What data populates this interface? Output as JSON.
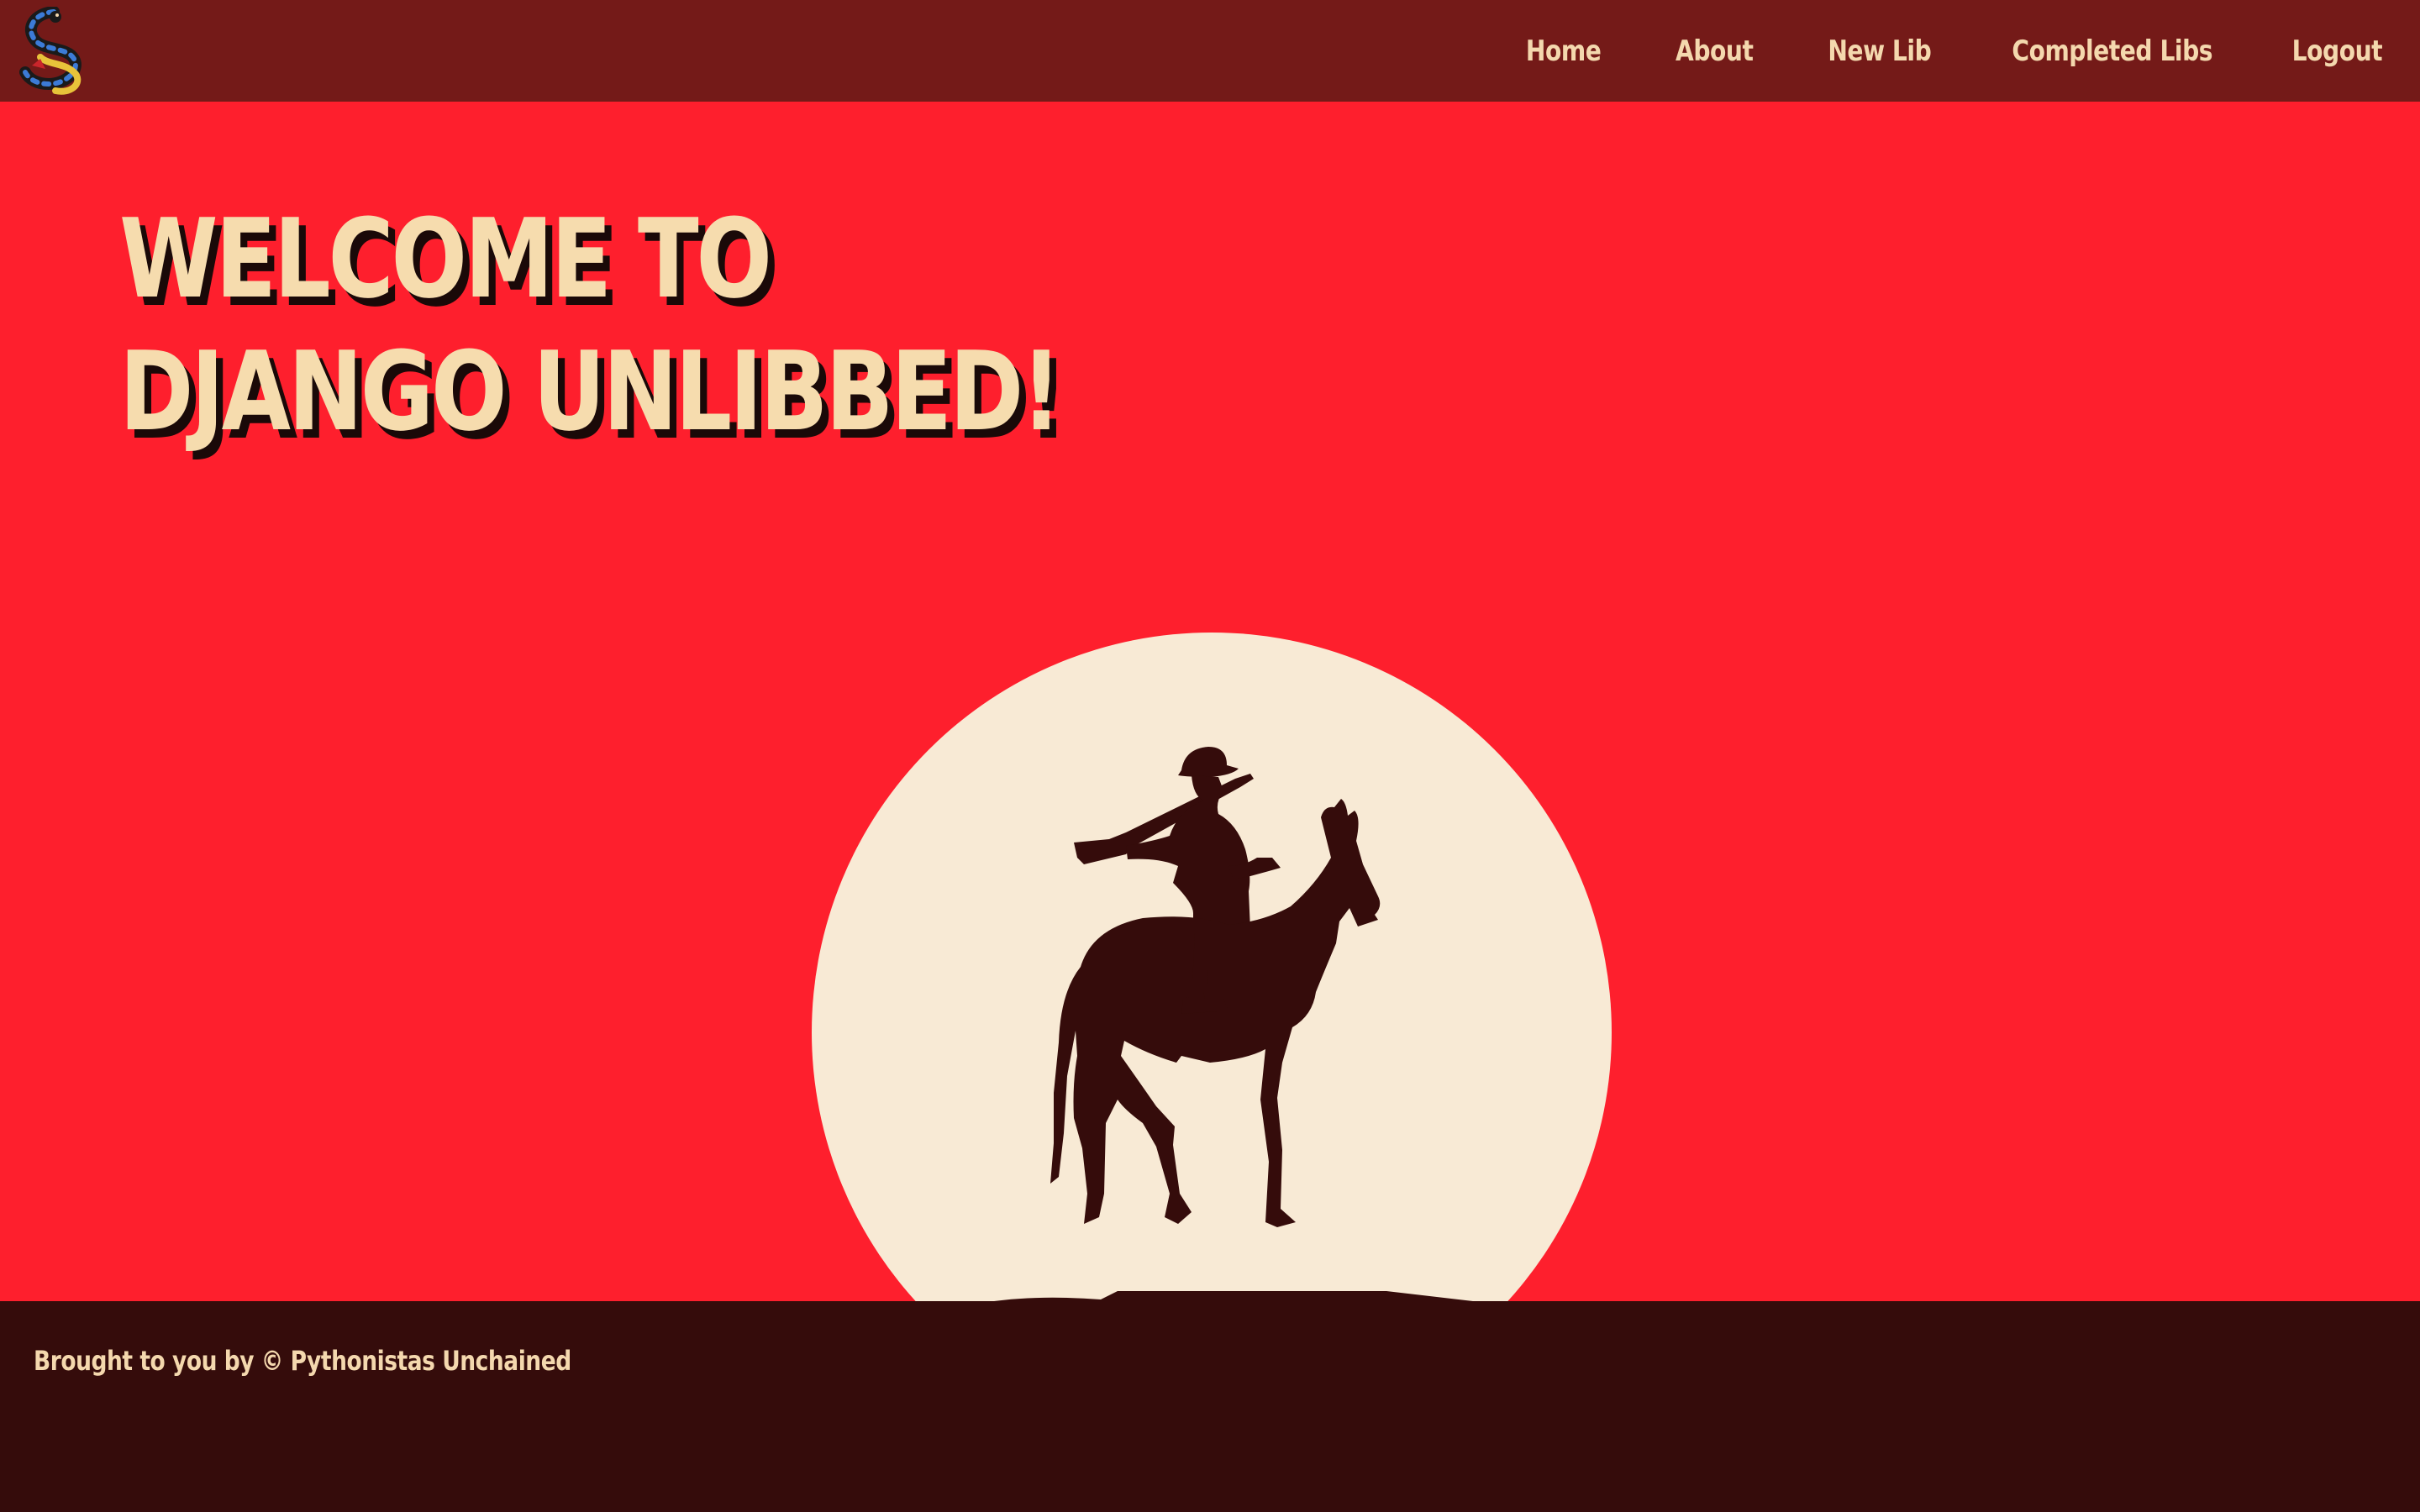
{
  "nav": {
    "logo_icon": "python-snake-logo-icon",
    "links": [
      "Home",
      "About",
      "New Lib",
      "Completed Libs",
      "Logout"
    ]
  },
  "hero": {
    "title_line1": "WELCOME TO",
    "title_line2": "DJANGO UNLIBBED!",
    "illustration": "cowboy-on-horse-silhouette-icon"
  },
  "footer": {
    "text": "Brought to you by © Pythonistas Unchained"
  },
  "colors": {
    "navbar": "#741a18",
    "hero_background": "#fe1f2d",
    "sun": "#f8ead5",
    "silhouette": "#350c0b",
    "footer": "#350c0b",
    "text_cream": "#f4d8ae"
  }
}
